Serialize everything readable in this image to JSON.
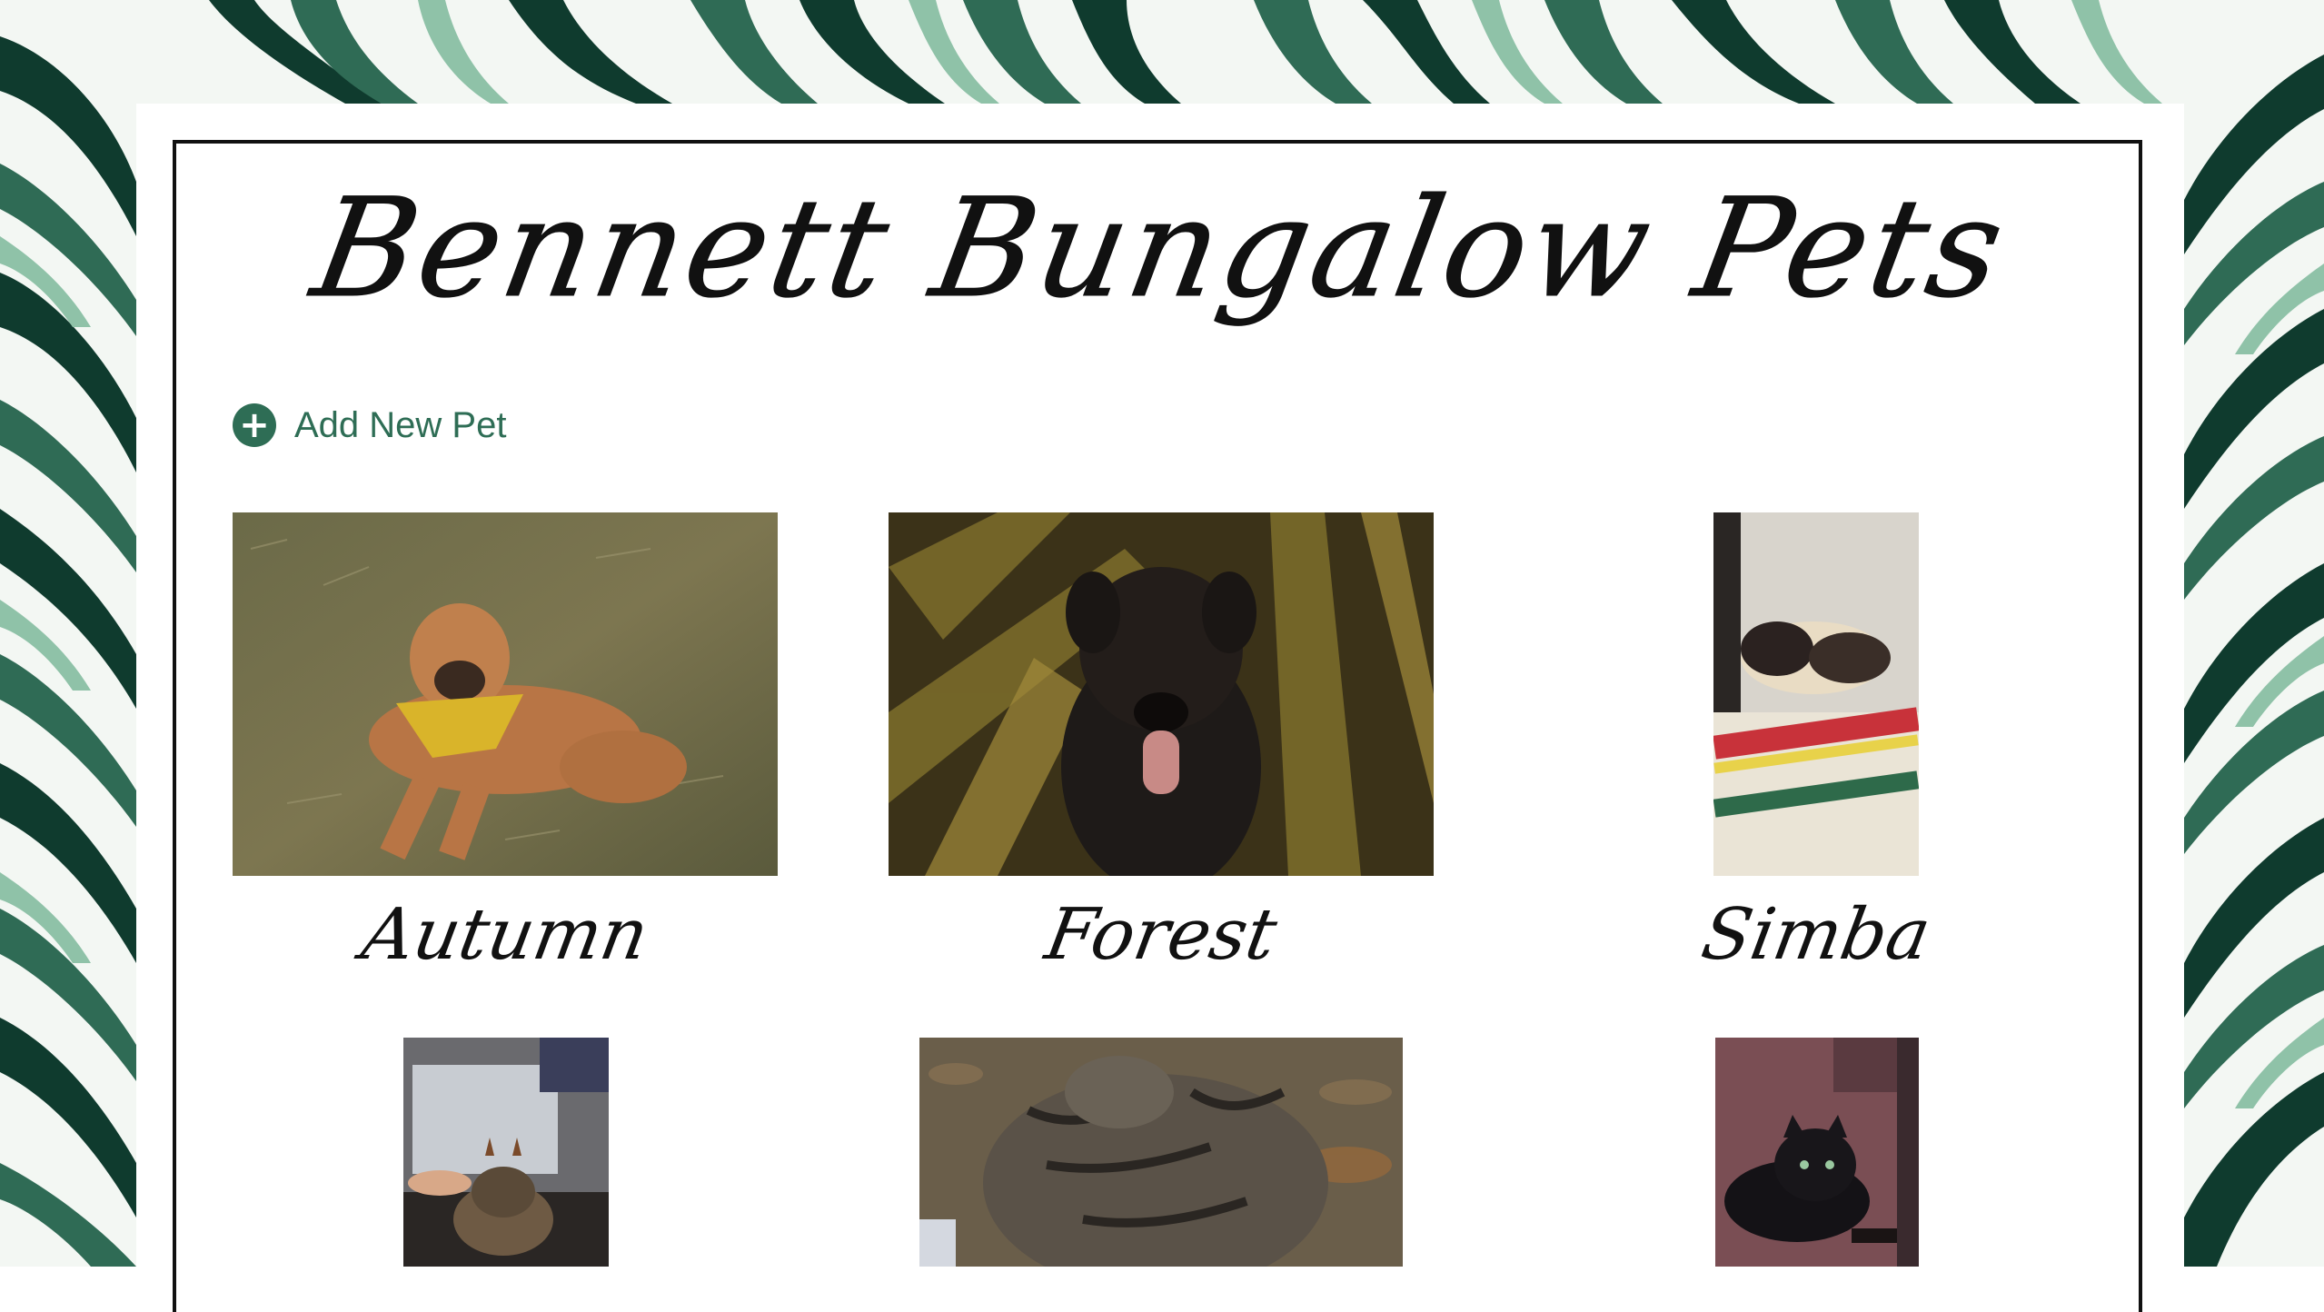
{
  "site": {
    "title": "Bennett Bungalow Pets"
  },
  "actions": {
    "add_pet_label": "Add New Pet",
    "add_pet_icon": "plus-circle-icon"
  },
  "colors": {
    "accent": "#2e6d55",
    "leaf_dark": "#0f3b2e",
    "leaf_mid": "#2f6b55",
    "leaf_light": "#8fc2a8",
    "card": "#ffffff"
  },
  "pets": [
    {
      "name": "Autumn",
      "photo": "dog-on-grass"
    },
    {
      "name": "Forest",
      "photo": "black-dog-in-sun"
    },
    {
      "name": "Simba",
      "photo": "siamese-cat-on-blanket"
    },
    {
      "name": "",
      "photo": "cat-with-antlers"
    },
    {
      "name": "",
      "photo": "tabby-cat-on-leaves"
    },
    {
      "name": "",
      "photo": "black-cat-on-floor"
    }
  ]
}
